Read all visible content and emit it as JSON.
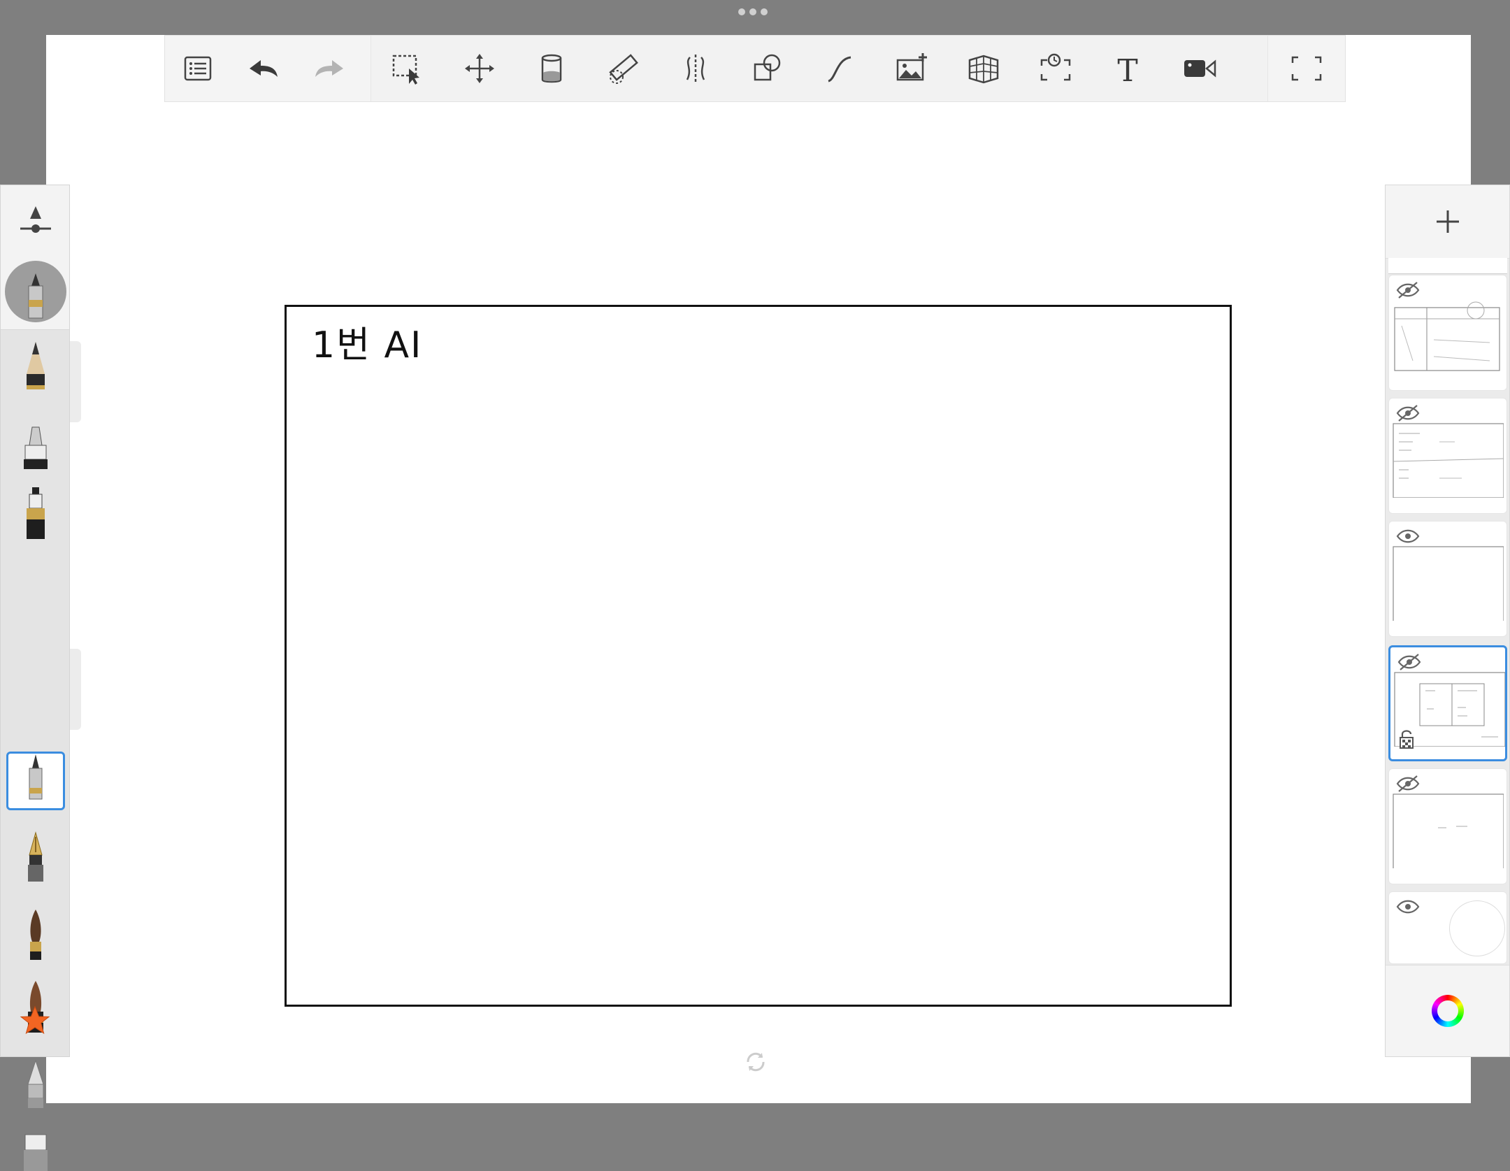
{
  "window": {
    "more_icon": "ellipsis-icon"
  },
  "toolbar": {
    "left": [
      {
        "name": "list-menu-icon"
      },
      {
        "name": "undo-icon"
      },
      {
        "name": "redo-icon"
      }
    ],
    "middle": [
      {
        "name": "selection-icon"
      },
      {
        "name": "move-transform-icon"
      },
      {
        "name": "fill-bucket-icon"
      },
      {
        "name": "ruler-icon"
      },
      {
        "name": "symmetry-icon"
      },
      {
        "name": "shape-icon"
      },
      {
        "name": "curve-icon"
      },
      {
        "name": "add-image-icon"
      },
      {
        "name": "perspective-grid-icon"
      },
      {
        "name": "time-lapse-icon"
      },
      {
        "name": "text-icon",
        "glyph": "T"
      },
      {
        "name": "video-camera-icon"
      }
    ],
    "right": [
      {
        "name": "fullscreen-icon"
      }
    ]
  },
  "brushbar": {
    "size_slider_icon": "brush-size-opacity-icon",
    "current_brush": "technical-pen-icon",
    "brushes": [
      "pencil-icon",
      "marker-icon",
      "ink-pen-icon",
      "technical-pen-icon",
      "fountain-pen-icon",
      "paintbrush-icon",
      "ink-brush-icon",
      "airbrush-icon",
      "chisel-marker-icon"
    ],
    "selected_index": 3,
    "favorites_icon": "star-icon",
    "favorites_color": "#f26522"
  },
  "canvas": {
    "handwritten_text": "1번 AI"
  },
  "layers": {
    "add_icon": "plus-icon",
    "items": [
      {
        "name": "layer-1",
        "visible": false
      },
      {
        "name": "layer-2",
        "visible": false
      },
      {
        "name": "layer-3",
        "visible": true
      },
      {
        "name": "layer-4",
        "visible": false,
        "active": true,
        "locked": true
      },
      {
        "name": "layer-5",
        "visible": false
      },
      {
        "name": "background-layer",
        "visible": true
      }
    ],
    "color_picker_icon": "color-wheel-icon"
  },
  "colors": {
    "accent": "#3b8de0",
    "panel": "#ebebeb",
    "frame": "#7f7f7f"
  }
}
